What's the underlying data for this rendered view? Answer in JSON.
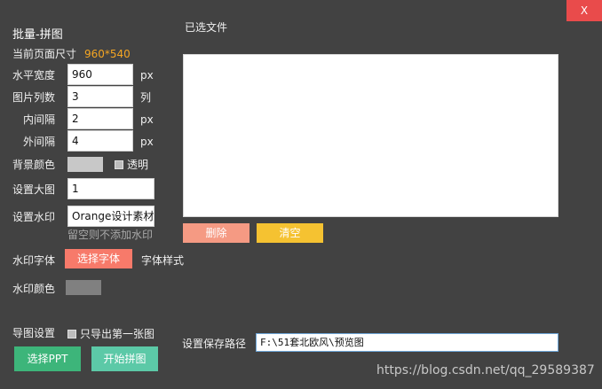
{
  "window": {
    "title": "批量-拼图",
    "close_label": "X"
  },
  "page_size": {
    "label": "当前页面尺寸",
    "value": "960*540"
  },
  "fields": {
    "width": {
      "label": "水平宽度",
      "value": "960",
      "unit": "px"
    },
    "columns": {
      "label": "图片列数",
      "value": "3",
      "unit": "列"
    },
    "inner_gap": {
      "label": "内间隔",
      "value": "2",
      "unit": "px"
    },
    "outer_gap": {
      "label": "外间隔",
      "value": "4",
      "unit": "px"
    },
    "background": {
      "label": "背景颜色",
      "swatch_color": "#c8c8c8",
      "transparent_label": "透明",
      "transparent_checked": false
    },
    "big_image": {
      "label": "设置大图",
      "value": "1"
    },
    "watermark": {
      "label": "设置水印",
      "value": "Orange设计素材",
      "hint": "留空则不添加水印"
    },
    "watermark_font": {
      "label": "水印字体",
      "button_label": "选择字体",
      "style_label": "字体样式"
    },
    "watermark_color": {
      "label": "水印颜色",
      "swatch_color": "#808080"
    }
  },
  "export": {
    "label": "导图设置",
    "first_only_label": "只导出第一张图",
    "first_only_checked": false,
    "select_ppt_label": "选择PPT",
    "start_label": "开始拼图"
  },
  "files": {
    "title": "已选文件",
    "items": [],
    "delete_label": "删除",
    "clear_label": "清空"
  },
  "save": {
    "label": "设置保存路径",
    "path": "F:\\51套北欧风\\预览图"
  },
  "watermark_overlay": "https://blog.csdn.net/qq_29589387",
  "colors": {
    "background": "#424242",
    "accent_orange": "#f5a623",
    "close_red": "#e94b4b",
    "delete_salmon": "#f59a83",
    "clear_yellow": "#f5c231",
    "select_font_coral": "#f77a6a",
    "select_ppt_green": "#3db57a",
    "start_mint": "#5cc9a7"
  }
}
